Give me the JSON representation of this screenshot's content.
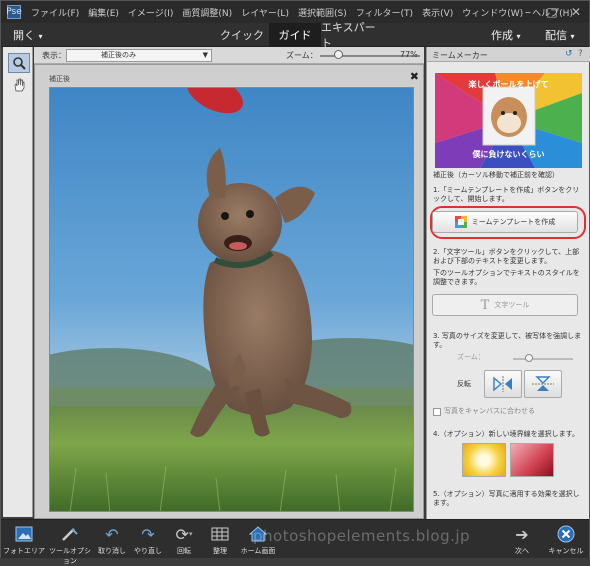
{
  "menubar": {
    "items": [
      "ファイル(F)",
      "編集(E)",
      "イメージ(I)",
      "画質調整(N)",
      "レイヤー(L)",
      "選択範囲(S)",
      "フィルター(T)",
      "表示(V)",
      "ウィンドウ(W)",
      "ヘルプ(H)"
    ],
    "minimize": "–",
    "maximize": "□",
    "close": "✕"
  },
  "modebar": {
    "open": "開く",
    "tabs": [
      "クイック",
      "ガイド",
      "エキスパート"
    ],
    "active_tab": "ガイド",
    "create": "作成",
    "share": "配信"
  },
  "options": {
    "view_label": "表示：",
    "view_value": "補正後のみ",
    "zoom_label": "ズーム：",
    "zoom_value": "77%"
  },
  "canvas": {
    "label": "補正後",
    "close": "✖"
  },
  "panel": {
    "title": "ミームメーカー",
    "meme_top": "楽しくボールを上げて",
    "meme_bottom": "僕に負けないくらい",
    "after_text": "補正後（カーソル移動で補正前を確認）",
    "step1": "1.「ミームテンプレートを作成」ボタンをクリックして、開始します。",
    "create_template_button": "ミームテンプレートを作成",
    "step2": "2.「文字ツール」ボタンをクリックして、上部および下部のテキストを変更します。",
    "step2b": "下のツールオプションでテキストのスタイルを調整できます。",
    "text_tool_button": "文字ツール",
    "step3": "3. 写真のサイズを変更して、被写体を強調します。",
    "zoom_label": "ズーム：",
    "flip_label": "反転",
    "fit_checkbox": "写真をキャンバスに合わせる",
    "step4": "4.（オプション）新しい境界線を選択します。",
    "step5": "5.（オプション）写真に適用する効果を選択します。"
  },
  "bottombar": {
    "photobin": "フォトエリア",
    "tooloptions": "ツールオプション",
    "undo": "取り消し",
    "redo": "やり直し",
    "rotate": "回転",
    "organize": "整理",
    "home": "ホーム画面",
    "next": "次へ",
    "cancel": "キャンセル",
    "watermark": "photoshopelements.blog.jp"
  },
  "colors": {
    "accent_blue": "#2a6fb5",
    "highlight_ring": "#e03030"
  }
}
